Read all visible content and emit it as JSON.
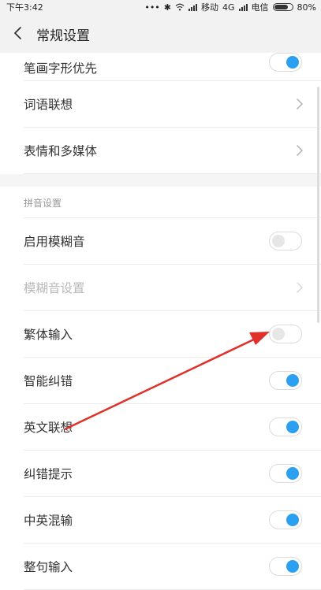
{
  "status_bar": {
    "time": "下午3:42",
    "dots": "•••",
    "carrier1": "移动",
    "network": "4G",
    "carrier2": "电信",
    "battery": "80%",
    "battery_level": 0.8
  },
  "header": {
    "title": "常规设置"
  },
  "settings_top": [
    {
      "label": "笔画字形优先",
      "type": "toggle",
      "on": true
    },
    {
      "label": "词语联想",
      "type": "link"
    },
    {
      "label": "表情和多媒体",
      "type": "link"
    }
  ],
  "pinyin_section": {
    "header": "拼音设置",
    "items": [
      {
        "label": "启用模糊音",
        "type": "toggle",
        "on": false
      },
      {
        "label": "模糊音设置",
        "type": "link",
        "disabled": true
      },
      {
        "label": "繁体输入",
        "type": "toggle",
        "on": false
      },
      {
        "label": "智能纠错",
        "type": "toggle",
        "on": true
      },
      {
        "label": "英文联想",
        "type": "toggle",
        "on": true
      },
      {
        "label": "纠错提示",
        "type": "toggle",
        "on": true
      },
      {
        "label": "中英混输",
        "type": "toggle",
        "on": true
      },
      {
        "label": "整句输入",
        "type": "toggle",
        "on": true
      }
    ]
  },
  "colors": {
    "accent": "#2ca0f0",
    "arrow": "#e0302a"
  }
}
